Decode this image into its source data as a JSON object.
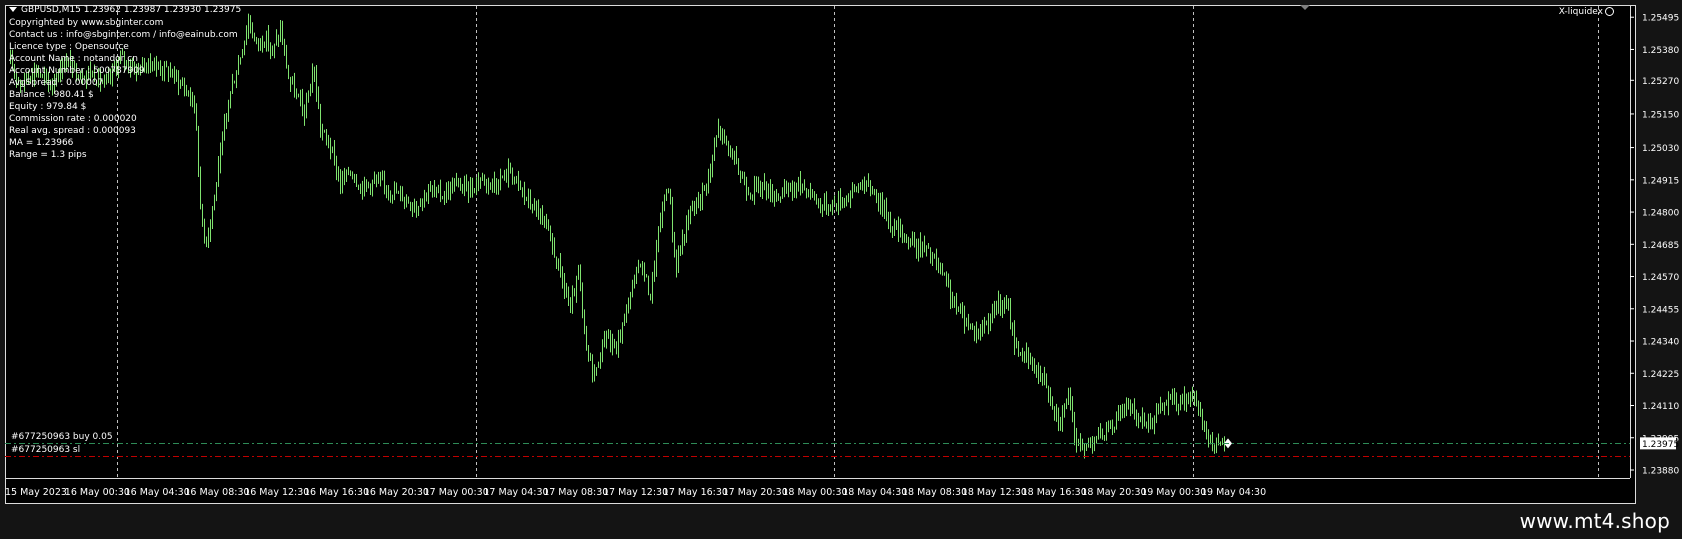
{
  "header": {
    "symbol_line": "GBPUSD,M15  1.23962 1.23987 1.23930 1.23975"
  },
  "indicator": {
    "name": "X-liquidex"
  },
  "info_panel": [
    "Copyrighted by www.sbginter.com",
    "Contact us : info@sbginter.com / info@eainub.com",
    "Licence type : Opensource",
    "Account Name : notandor cn",
    "Account Number : 500787909",
    "AvgSpread : 0.00007",
    "Balance : 980.41 $",
    "Equity : 979.84 $",
    "Commission rate : 0.000020",
    "Real avg. spread : 0.000093",
    "MA = 1.23966",
    "Range = 1.3 pips"
  ],
  "orders": [
    {
      "label": "#677250963 buy 0.05",
      "price": 1.23975,
      "color": "#2e8b57"
    },
    {
      "label": "#677250963 sl",
      "price": 1.2393,
      "color": "#c00000"
    }
  ],
  "current_price_label": "1.23975",
  "watermark": "www.mt4.shop",
  "colors": {
    "background": "#000000",
    "candle": "#7fe36f",
    "axis_text": "#ffffff",
    "grid": "#c0c0c0"
  },
  "chart_data": {
    "type": "candlestick",
    "symbol": "GBPUSD",
    "timeframe": "M15",
    "y_ticks": [
      1.25495,
      1.2538,
      1.2527,
      1.2515,
      1.2503,
      1.24915,
      1.248,
      1.24685,
      1.2457,
      1.24455,
      1.2434,
      1.24225,
      1.2411,
      1.23995,
      1.2388
    ],
    "ylim": [
      1.23855,
      1.25535
    ],
    "x_labels": [
      "15 May 2023",
      "16 May 00:30",
      "16 May 04:30",
      "16 May 08:30",
      "16 May 12:30",
      "16 May 16:30",
      "16 May 20:30",
      "17 May 00:30",
      "17 May 04:30",
      "17 May 08:30",
      "17 May 12:30",
      "17 May 16:30",
      "17 May 20:30",
      "18 May 00:30",
      "18 May 04:30",
      "18 May 08:30",
      "18 May 12:30",
      "18 May 16:30",
      "18 May 20:30",
      "19 May 00:30",
      "19 May 04:30"
    ],
    "day_separators": [
      "16 May 00:30",
      "17 May 00:30",
      "18 May 00:30",
      "19 May 00:30"
    ],
    "price_path": [
      [
        0,
        1.2533
      ],
      [
        10,
        1.2526
      ],
      [
        25,
        1.2531
      ],
      [
        40,
        1.2525
      ],
      [
        55,
        1.2534
      ],
      [
        70,
        1.2529
      ],
      [
        80,
        1.253
      ],
      [
        95,
        1.2525
      ],
      [
        110,
        1.2535
      ],
      [
        125,
        1.2531
      ],
      [
        140,
        1.2533
      ],
      [
        160,
        1.253
      ],
      [
        175,
        1.2524
      ],
      [
        185,
        1.2518
      ],
      [
        190,
        1.2481
      ],
      [
        195,
        1.2469
      ],
      [
        202,
        1.2481
      ],
      [
        210,
        1.25
      ],
      [
        218,
        1.252
      ],
      [
        228,
        1.2533
      ],
      [
        238,
        1.2548
      ],
      [
        246,
        1.254
      ],
      [
        255,
        1.2542
      ],
      [
        262,
        1.2537
      ],
      [
        270,
        1.2545
      ],
      [
        278,
        1.2528
      ],
      [
        285,
        1.2522
      ],
      [
        295,
        1.2515
      ],
      [
        303,
        1.2532
      ],
      [
        310,
        1.251
      ],
      [
        320,
        1.2503
      ],
      [
        330,
        1.249
      ],
      [
        340,
        1.2495
      ],
      [
        350,
        1.2489
      ],
      [
        365,
        1.2491
      ],
      [
        380,
        1.2488
      ],
      [
        395,
        1.2485
      ],
      [
        405,
        1.2482
      ],
      [
        418,
        1.2488
      ],
      [
        432,
        1.2486
      ],
      [
        445,
        1.249
      ],
      [
        460,
        1.2488
      ],
      [
        470,
        1.2492
      ],
      [
        485,
        1.249
      ],
      [
        500,
        1.2495
      ],
      [
        515,
        1.2485
      ],
      [
        528,
        1.248
      ],
      [
        540,
        1.247
      ],
      [
        550,
        1.2458
      ],
      [
        560,
        1.2445
      ],
      [
        568,
        1.2458
      ],
      [
        576,
        1.243
      ],
      [
        585,
        1.2422
      ],
      [
        595,
        1.2437
      ],
      [
        605,
        1.243
      ],
      [
        618,
        1.2448
      ],
      [
        630,
        1.2463
      ],
      [
        640,
        1.245
      ],
      [
        650,
        1.2478
      ],
      [
        658,
        1.249
      ],
      [
        665,
        1.246
      ],
      [
        672,
        1.247
      ],
      [
        680,
        1.248
      ],
      [
        692,
        1.2487
      ],
      [
        700,
        1.2495
      ],
      [
        708,
        1.251
      ],
      [
        715,
        1.2505
      ],
      [
        722,
        1.25
      ],
      [
        730,
        1.2493
      ],
      [
        740,
        1.2487
      ],
      [
        752,
        1.249
      ],
      [
        762,
        1.2486
      ],
      [
        775,
        1.2487
      ],
      [
        790,
        1.249
      ],
      [
        800,
        1.2487
      ],
      [
        812,
        1.2482
      ],
      [
        825,
        1.2483
      ],
      [
        838,
        1.2486
      ],
      [
        850,
        1.249
      ],
      [
        862,
        1.2488
      ],
      [
        872,
        1.2482
      ],
      [
        882,
        1.2475
      ],
      [
        893,
        1.2472
      ],
      [
        905,
        1.2468
      ],
      [
        915,
        1.2467
      ],
      [
        925,
        1.2462
      ],
      [
        935,
        1.2455
      ],
      [
        945,
        1.2446
      ],
      [
        958,
        1.244
      ],
      [
        968,
        1.2437
      ],
      [
        978,
        1.2442
      ],
      [
        988,
        1.2447
      ],
      [
        998,
        1.2445
      ],
      [
        1005,
        1.2432
      ],
      [
        1015,
        1.2428
      ],
      [
        1025,
        1.2424
      ],
      [
        1035,
        1.242
      ],
      [
        1042,
        1.2412
      ],
      [
        1050,
        1.2405
      ],
      [
        1057,
        1.2415
      ],
      [
        1065,
        1.24
      ],
      [
        1072,
        1.2395
      ],
      [
        1080,
        1.2399
      ],
      [
        1090,
        1.24
      ],
      [
        1098,
        1.2402
      ],
      [
        1105,
        1.2406
      ],
      [
        1112,
        1.2411
      ],
      [
        1120,
        1.2409
      ],
      [
        1130,
        1.2406
      ],
      [
        1140,
        1.2405
      ],
      [
        1150,
        1.241
      ],
      [
        1160,
        1.2413
      ],
      [
        1170,
        1.2412
      ],
      [
        1180,
        1.2414
      ],
      [
        1188,
        1.241
      ],
      [
        1195,
        1.2402
      ],
      [
        1202,
        1.2397
      ],
      [
        1210,
        1.2396
      ],
      [
        1214,
        1.23975
      ]
    ]
  }
}
